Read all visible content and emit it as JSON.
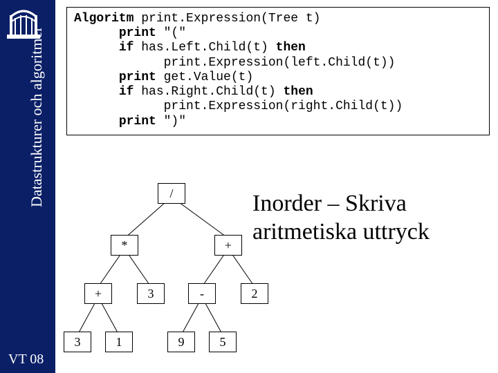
{
  "sidebar": {
    "label": "Datastrukturer och algoritmer"
  },
  "footer": {
    "label": "VT 08"
  },
  "algorithm": {
    "kw_alg": "Algoritm",
    "fn1": " print.Expression(Tree t)",
    "kw_print1": "print",
    "s_paren_open": " \"(\"",
    "kw_if1": "if",
    "s_if1": " has.Left.Child(t) ",
    "kw_then1": "then",
    "s_rec1": "print.Expression(left.Child(t))",
    "kw_print2": "print",
    "s_val": " get.Value(t)",
    "kw_if2": "if",
    "s_if2": " has.Right.Child(t) ",
    "kw_then2": "then",
    "s_rec2": "print.Expression(right.Child(t))",
    "kw_print3": "print",
    "s_paren_close": " \")\""
  },
  "heading": {
    "line1": "Inorder – Skriva",
    "line2": "aritmetiska uttryck"
  },
  "tree": {
    "n_root": "/",
    "n_l": "*",
    "n_r": "+",
    "n_ll": "+",
    "n_lr": "3",
    "n_rl": "-",
    "n_rr": "2",
    "n_lll": "3",
    "n_llr": "1",
    "n_rll": "9",
    "n_rlr": "5"
  }
}
